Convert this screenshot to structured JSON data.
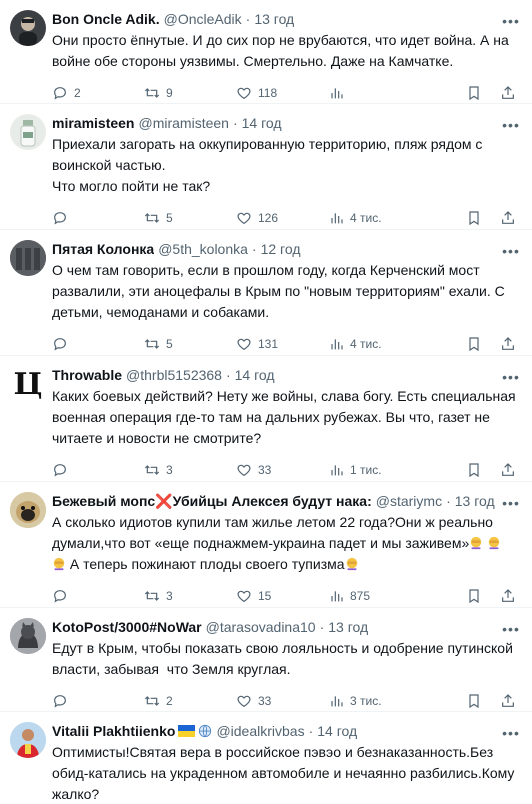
{
  "tweets": [
    {
      "name": "Bon Oncle Adik.",
      "handle": "@OncleAdik",
      "time": "13 год",
      "text": "Они просто ёпнутые. И до сих пор не врубаются, что идет война. А на\nвойне обе стороны уязвимы. Смертельно. Даже на Камчатке.",
      "replies": "2",
      "retweets": "9",
      "likes": "118",
      "views": "",
      "avatar_color": "#3b3f44"
    },
    {
      "name": "miramisteen",
      "handle": "@miramisteen",
      "time": "14 год",
      "text": "Приехали загорать на оккупированную территорию, пляж рядом с\nвоинской частью.\nЧто могло пойти не так?",
      "replies": "",
      "retweets": "5",
      "likes": "126",
      "views": "4 тис.",
      "avatar_color": "#e8ece9"
    },
    {
      "name": "Пятая Колонка",
      "handle": "@5th_kolonka",
      "time": "12 год",
      "text": "О чем там говорить, если в прошлом году, когда Керченский мост\nразвалили, эти аноцефалы в Крым по \"новым территориям\" ехали. С\nдетьми, чемоданами и собаками.",
      "replies": "",
      "retweets": "5",
      "likes": "131",
      "views": "4 тис.",
      "avatar_color": "#6b6f74"
    },
    {
      "name": "Throwable",
      "handle": "@thrbl5152368",
      "time": "14 год",
      "text": "Каких боевых действий? Нету же войны, слава богу. Есть специальная\nвоенная операция где-то там на дальних рубежах. Вы что, газет не\nчитаете и новости не смотрите?",
      "replies": "",
      "retweets": "3",
      "likes": "33",
      "views": "1 тис.",
      "avatar_color": "#ffffff",
      "avatar_letter": "Ц"
    },
    {
      "name": "Бежевый мопс❌Убийцы Алексея будут нака:",
      "handle": "@stariymc",
      "time": "13 год",
      "text_parts": [
        "А сколько идиотов купили там жилье летом 22 года?Они ж реально\nдумали,что вот «еще поднажмем-украина падет и мы заживем»",
        " ",
        "\n",
        " А теперь пожинают плоды своего тупизма"
      ],
      "replies": "",
      "retweets": "3",
      "likes": "15",
      "views": "875",
      "avatar_color": "#c9b48a"
    },
    {
      "name": "KotoPost/3000#NoWar",
      "handle": "@tarasovadina10",
      "time": "13 год",
      "text": "Едут в Крым, чтобы показать свою лояльность и одобрение путинской\nвласти, забывая  что Земля круглая.",
      "replies": "",
      "retweets": "2",
      "likes": "33",
      "views": "3 тис.",
      "avatar_color": "#8a8f95"
    },
    {
      "name": "Vitalii Plakhtiienko",
      "handle": "@idealkrivbas",
      "time": "14 год",
      "text": "Оптимисты!Святая вера в российское пэвэо и безнаказанность.Без\nобид-катались на украденном автомобиле и нечаянно разбились.Кому\nжалко?",
      "replies": "",
      "retweets": "",
      "likes": "",
      "views": "",
      "avatar_color": "#cfe3f5"
    }
  ],
  "icons": {
    "reply": "reply-icon",
    "retweet": "retweet-icon",
    "like": "heart-icon",
    "views": "views-icon",
    "bookmark": "bookmark-icon",
    "share": "share-icon",
    "more": "more-icon"
  }
}
